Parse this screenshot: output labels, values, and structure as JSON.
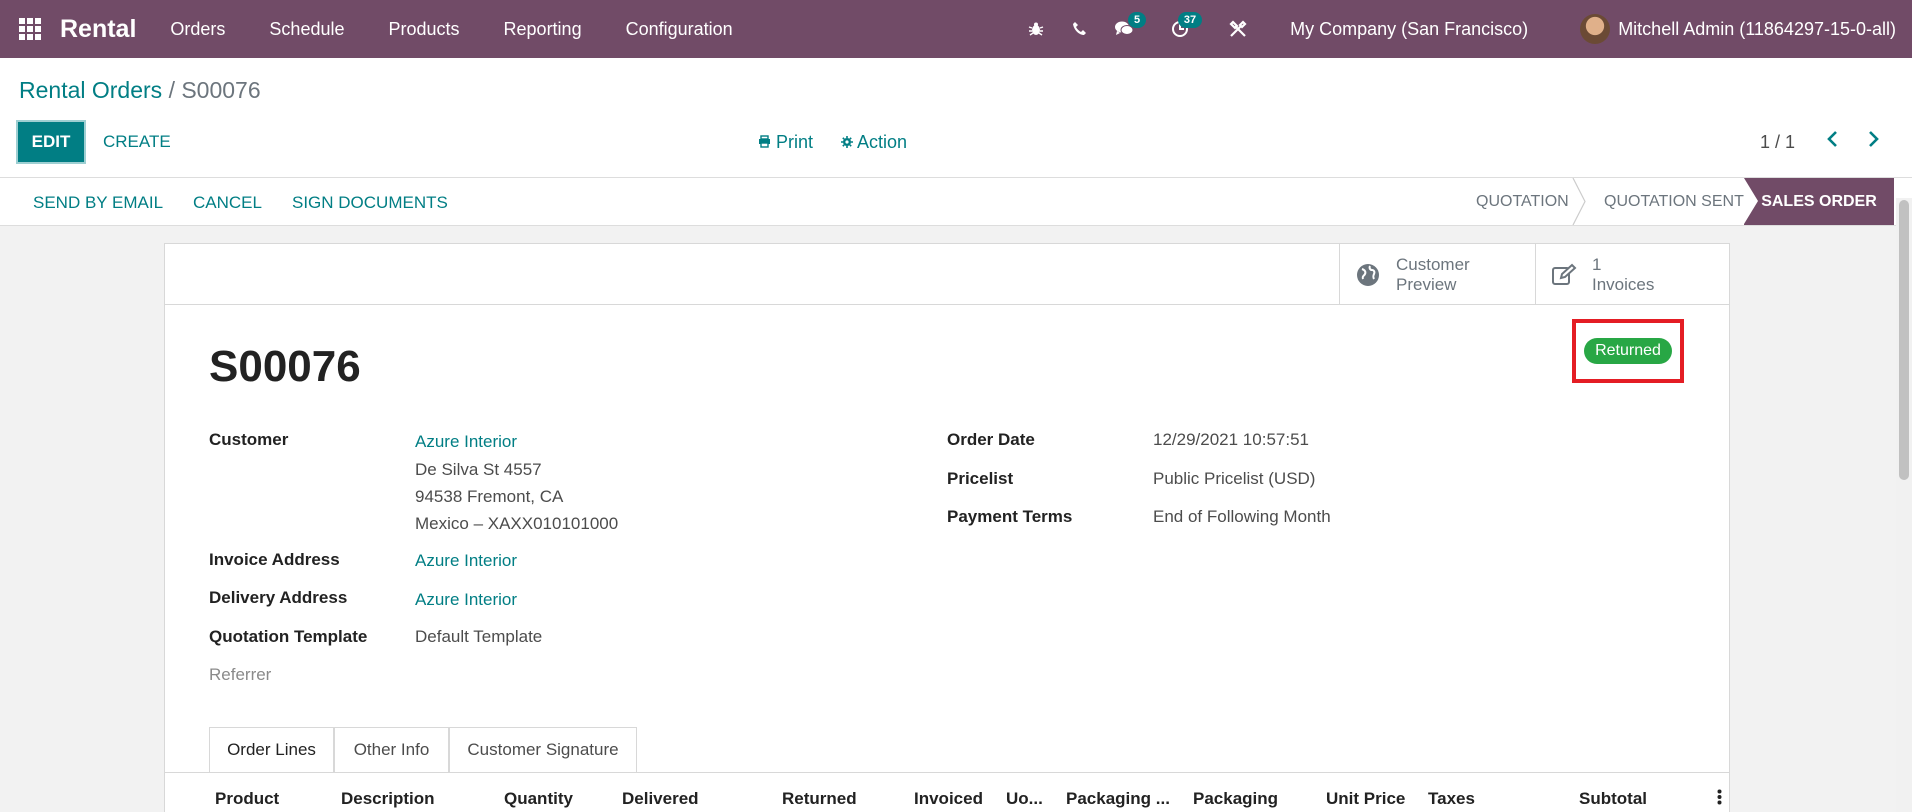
{
  "nav": {
    "app_name": "Rental",
    "menu": [
      "Orders",
      "Schedule",
      "Products",
      "Reporting",
      "Configuration"
    ],
    "messages_badge": "5",
    "activities_badge": "37",
    "company": "My Company (San Francisco)",
    "user": "Mitchell Admin (11864297-15-0-all)"
  },
  "breadcrumb": {
    "parent": "Rental Orders",
    "separator": "/",
    "current": "S00076"
  },
  "toolbar": {
    "edit_label": "EDIT",
    "create_label": "CREATE",
    "print_label": "Print",
    "action_label": "Action",
    "pager": "1 / 1"
  },
  "statusbar": {
    "buttons": [
      "SEND BY EMAIL",
      "CANCEL",
      "SIGN DOCUMENTS"
    ],
    "stages": [
      "QUOTATION",
      "QUOTATION SENT",
      "SALES ORDER"
    ],
    "active_stage": "SALES ORDER"
  },
  "smart_buttons": {
    "customer_preview": [
      "Customer",
      "Preview"
    ],
    "invoices": [
      "1",
      "Invoices"
    ]
  },
  "record": {
    "name": "S00076",
    "status_badge": "Returned",
    "fields": {
      "customer_label": "Customer",
      "customer_name": "Azure Interior",
      "customer_address": [
        "De Silva St 4557",
        "94538 Fremont, CA",
        "Mexico – XAXX010101000"
      ],
      "invoice_address_label": "Invoice Address",
      "invoice_address": "Azure Interior",
      "delivery_address_label": "Delivery Address",
      "delivery_address": "Azure Interior",
      "quotation_template_label": "Quotation Template",
      "quotation_template": "Default Template",
      "referrer_label": "Referrer",
      "order_date_label": "Order Date",
      "order_date": "12/29/2021 10:57:51",
      "pricelist_label": "Pricelist",
      "pricelist": "Public Pricelist (USD)",
      "payment_terms_label": "Payment Terms",
      "payment_terms": "End of Following Month"
    }
  },
  "notebook": {
    "tabs": [
      "Order Lines",
      "Other Info",
      "Customer Signature"
    ],
    "active_tab": "Order Lines",
    "columns": [
      "Product",
      "Description",
      "Quantity",
      "Delivered",
      "Returned",
      "Invoiced",
      "Uo...",
      "Packaging ...",
      "Packaging",
      "Unit Price",
      "Taxes",
      "Subtotal"
    ]
  },
  "colors": {
    "brand": "#714b67",
    "accent": "#017e84",
    "success": "#28a745",
    "highlight": "#e41d24"
  }
}
